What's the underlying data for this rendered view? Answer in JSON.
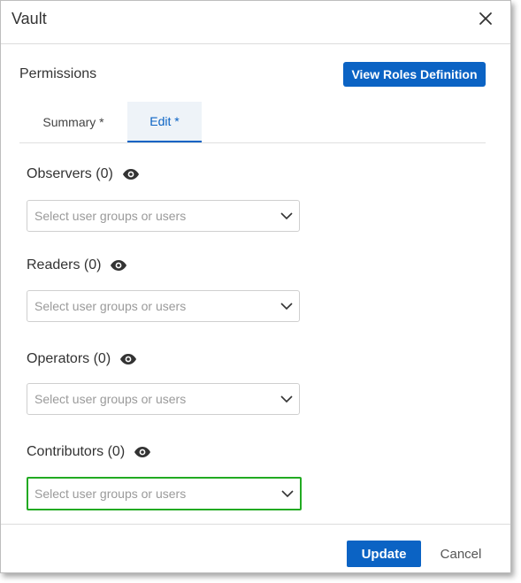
{
  "dialog": {
    "title": "Vault",
    "close_icon": "close-icon"
  },
  "permissions": {
    "title": "Permissions",
    "view_roles_label": "View Roles Definition"
  },
  "tabs": [
    {
      "label": "Summary *",
      "active": false
    },
    {
      "label": "Edit *",
      "active": true
    }
  ],
  "groups": [
    {
      "label": "Observers (0)",
      "placeholder": "Select user groups or users",
      "icon": "eye-icon"
    },
    {
      "label": "Readers (0)",
      "placeholder": "Select user groups or users",
      "icon": "eye-icon"
    },
    {
      "label": "Operators (0)",
      "placeholder": "Select user groups or users",
      "icon": "eye-icon"
    },
    {
      "label": "Contributors (0)",
      "placeholder": "Select user groups or users",
      "icon": "eye-icon",
      "focused": true
    }
  ],
  "footer": {
    "update_label": "Update",
    "cancel_label": "Cancel"
  },
  "colors": {
    "primary": "#0b63c4",
    "focus_outline": "#22aa22",
    "placeholder": "#9a9a9a"
  }
}
